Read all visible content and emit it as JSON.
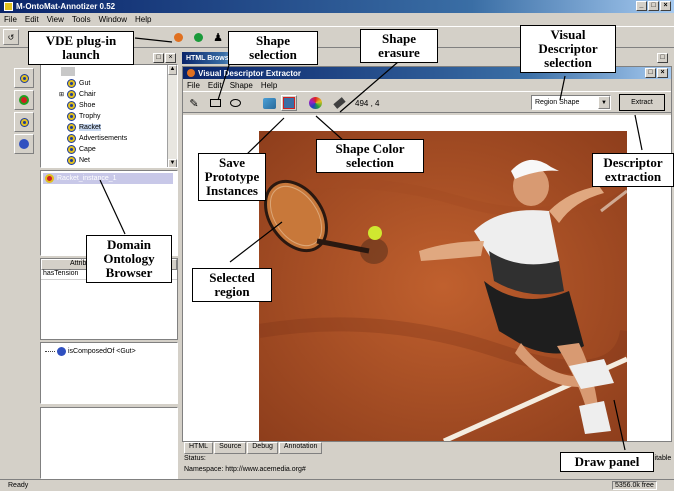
{
  "app": {
    "title": "M-OntoMat-Annotizer 0.52",
    "menu": [
      "File",
      "Edit",
      "View",
      "Tools",
      "Window",
      "Help"
    ]
  },
  "html_browser": {
    "title": "HTML Browser"
  },
  "tree": {
    "items": [
      "Gut",
      "Chair",
      "Shoe",
      "Trophy",
      "Racket",
      "Advertisements",
      "Cape",
      "Net"
    ],
    "selected": "Racket"
  },
  "instance": {
    "label": "Racket_instance_1"
  },
  "attributes": {
    "header": "Attributes",
    "row": "hasTension"
  },
  "relations": {
    "row": "isComposedOf <Gut>"
  },
  "vde": {
    "title": "Visual Descriptor Extractor",
    "menu": [
      "File",
      "Edit",
      "Shape",
      "Help"
    ],
    "coords": "494 , 4",
    "descriptor_selected": "Region Shape",
    "extract_label": "Extract"
  },
  "bottom": {
    "tabs": [
      "HTML",
      "Source",
      "Debug",
      "Annotation"
    ],
    "status": "Status:",
    "namespace": "Namespace: http://www.acemedia.org#",
    "editable": "Editable"
  },
  "statusbar": {
    "left": "Ready",
    "right": "5356.0k free"
  },
  "annotations": {
    "vde_launch": "VDE plug-in launch",
    "shape_selection": "Shape selection",
    "shape_erasure": "Shape erasure",
    "visual_descriptor": "Visual Descriptor selection",
    "save_prototype": "Save Prototype Instances",
    "shape_color": "Shape Color selection",
    "descriptor_extraction": "Descriptor extraction",
    "domain_ontology": "Domain Ontology Browser",
    "selected_region": "Selected region",
    "draw_panel": "Draw panel"
  },
  "colors": {
    "titlebar": "#0a246a",
    "clay": "#b4542a",
    "accent": "#3a6ea5"
  }
}
